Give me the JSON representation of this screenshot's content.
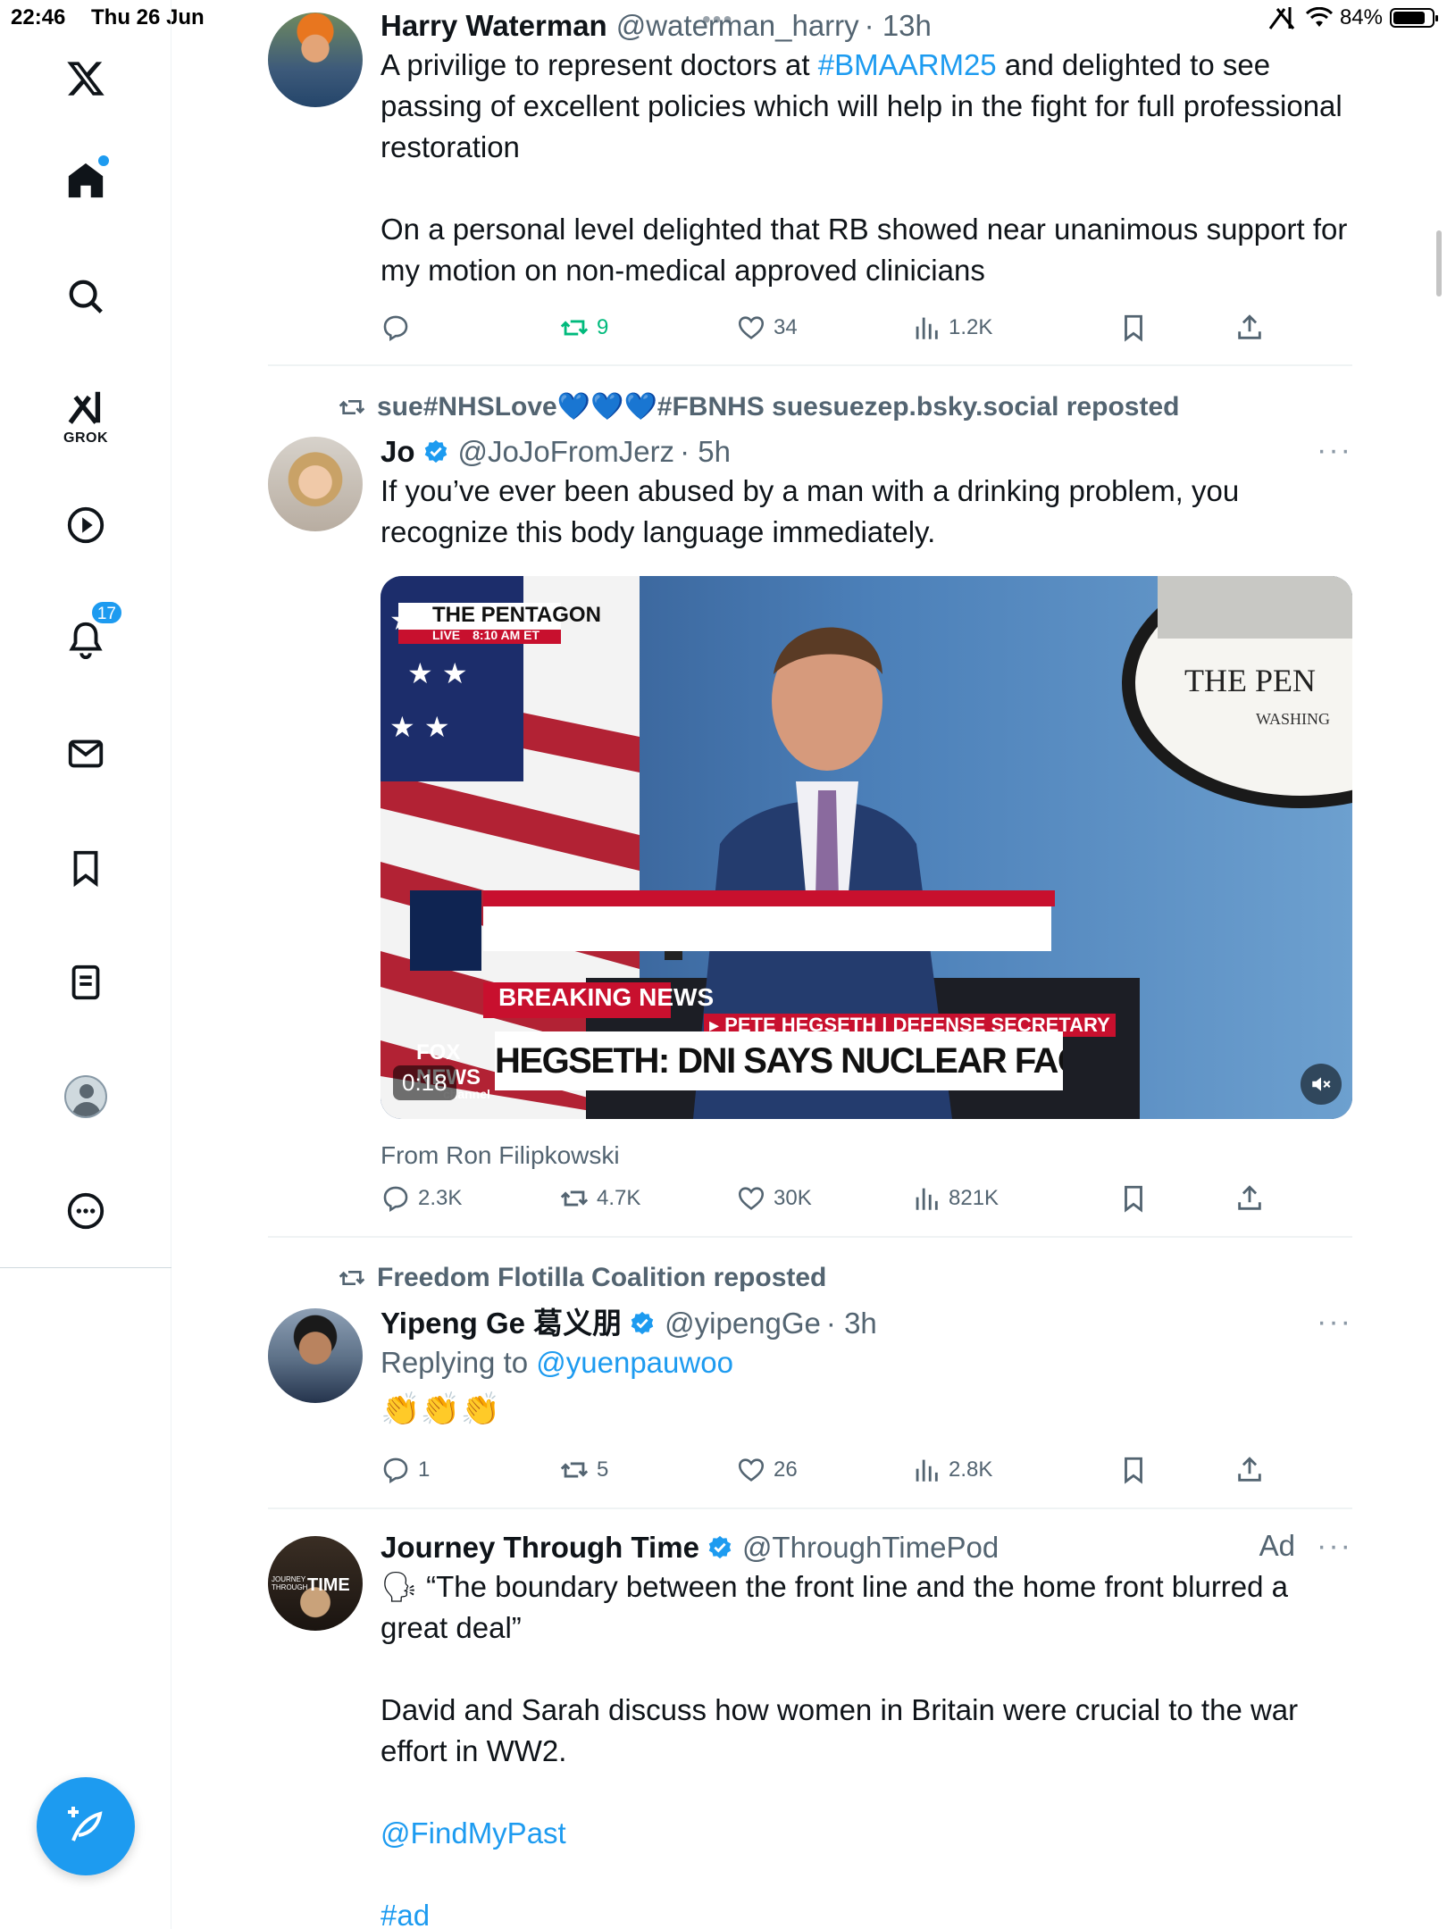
{
  "status_bar": {
    "time": "22:46",
    "date": "Thu 26 Jun",
    "battery": "84%",
    "battery_level": 0.84
  },
  "sidebar": {
    "items": [
      {
        "name": "home",
        "icon": "home-icon"
      },
      {
        "name": "explore",
        "icon": "search-icon"
      },
      {
        "name": "grok",
        "icon": "grok-icon",
        "label": "GROK"
      },
      {
        "name": "video",
        "icon": "play-circle-icon"
      },
      {
        "name": "notifications",
        "icon": "bell-icon",
        "badge": "17"
      },
      {
        "name": "messages",
        "icon": "envelope-icon"
      },
      {
        "name": "bookmarks",
        "icon": "bookmark-icon"
      },
      {
        "name": "lists",
        "icon": "list-icon"
      },
      {
        "name": "profile",
        "icon": "avatar-icon"
      },
      {
        "name": "more",
        "icon": "more-circle-icon"
      }
    ],
    "compose_icon": "compose-feather-icon"
  },
  "tweets": [
    {
      "name": "Harry Waterman",
      "handle": "@waterman_harry",
      "time": "· 13h",
      "text_before": "A privilige to represent doctors at ",
      "hashtag": "#BMAARM25",
      "text_after": " and delighted to see passing of excellent policies which will help in the fight for full professional restoration",
      "text2": "On a personal level delighted that RB showed near unanimous support for my motion on non-medical approved clinicians",
      "replies": "",
      "reposts": "9",
      "likes": "34",
      "views": "1.2K"
    },
    {
      "repost_by": "sue#NHSLove💙💙💙#FBNHS suesuezep.bsky.social reposted",
      "name": "Jo",
      "handle": "@JoJoFromJerz",
      "time": "· 5h",
      "text": "If you’ve ever been abused by a man with a drinking problem, you recognize this body language immediately.",
      "video": {
        "duration": "0:18",
        "tag_location": "THE PENTAGON",
        "tag_live": "LIVE",
        "tag_time": "8:10 AM ET",
        "breaking": "BREAKING NEWS",
        "subtitle": "▸ PETE HEGSETH | DEFENSE SECRETARY",
        "headline": "HEGSETH: DNI SAYS NUCLEAR FACILITIES DESTROYED",
        "network": "FOX NEWS",
        "network_sub": "channel",
        "seal_text": "THE PEN",
        "seal_sub": "WASHING"
      },
      "from": "From Ron Filipkowski",
      "replies": "2.3K",
      "reposts": "4.7K",
      "likes": "30K",
      "views": "821K"
    },
    {
      "repost_by": "Freedom Flotilla Coalition reposted",
      "name": "Yipeng Ge 葛义朋",
      "handle": "@yipengGe",
      "time": "· 3h",
      "replying_prefix": "Replying to ",
      "replying_to": "@yuenpauwoo",
      "text": "👏👏👏",
      "replies": "1",
      "reposts": "5",
      "likes": "26",
      "views": "2.8K"
    },
    {
      "name": "Journey Through Time",
      "handle": "@ThroughTimePod",
      "ad": "Ad",
      "quote_icon": "🗣",
      "text": "“The boundary between the front line and the home front blurred a great deal”",
      "text2": "David and Sarah discuss how women in Britain were crucial to the war effort in WW2.",
      "mention": "@FindMyPast",
      "hashtag": "#ad",
      "avatar_text": "TIME",
      "avatar_small": "JOURNEY THROUGH"
    }
  ],
  "colors": {
    "accent": "#1d9bf0",
    "repost_green": "#00ba7c",
    "muted": "#536471"
  }
}
